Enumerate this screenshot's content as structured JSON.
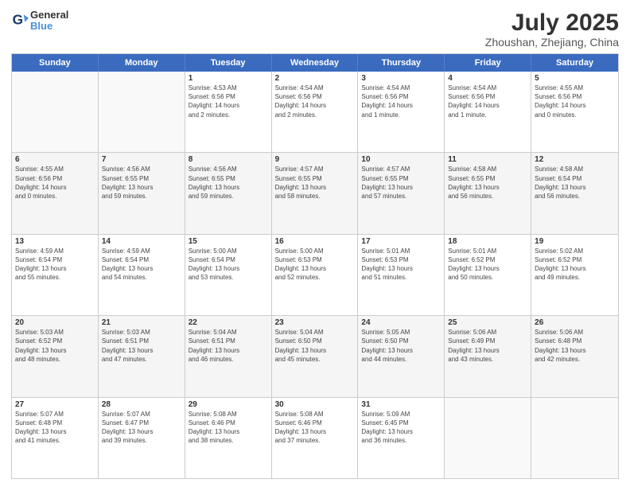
{
  "header": {
    "logo_line1": "General",
    "logo_line2": "Blue",
    "title": "July 2025",
    "subtitle": "Zhoushan, Zhejiang, China"
  },
  "days_of_week": [
    "Sunday",
    "Monday",
    "Tuesday",
    "Wednesday",
    "Thursday",
    "Friday",
    "Saturday"
  ],
  "rows": [
    [
      {
        "day": "",
        "detail": ""
      },
      {
        "day": "",
        "detail": ""
      },
      {
        "day": "1",
        "detail": "Sunrise: 4:53 AM\nSunset: 6:56 PM\nDaylight: 14 hours\nand 2 minutes."
      },
      {
        "day": "2",
        "detail": "Sunrise: 4:54 AM\nSunset: 6:56 PM\nDaylight: 14 hours\nand 2 minutes."
      },
      {
        "day": "3",
        "detail": "Sunrise: 4:54 AM\nSunset: 6:56 PM\nDaylight: 14 hours\nand 1 minute."
      },
      {
        "day": "4",
        "detail": "Sunrise: 4:54 AM\nSunset: 6:56 PM\nDaylight: 14 hours\nand 1 minute."
      },
      {
        "day": "5",
        "detail": "Sunrise: 4:55 AM\nSunset: 6:56 PM\nDaylight: 14 hours\nand 0 minutes."
      }
    ],
    [
      {
        "day": "6",
        "detail": "Sunrise: 4:55 AM\nSunset: 6:56 PM\nDaylight: 14 hours\nand 0 minutes."
      },
      {
        "day": "7",
        "detail": "Sunrise: 4:56 AM\nSunset: 6:55 PM\nDaylight: 13 hours\nand 59 minutes."
      },
      {
        "day": "8",
        "detail": "Sunrise: 4:56 AM\nSunset: 6:55 PM\nDaylight: 13 hours\nand 59 minutes."
      },
      {
        "day": "9",
        "detail": "Sunrise: 4:57 AM\nSunset: 6:55 PM\nDaylight: 13 hours\nand 58 minutes."
      },
      {
        "day": "10",
        "detail": "Sunrise: 4:57 AM\nSunset: 6:55 PM\nDaylight: 13 hours\nand 57 minutes."
      },
      {
        "day": "11",
        "detail": "Sunrise: 4:58 AM\nSunset: 6:55 PM\nDaylight: 13 hours\nand 56 minutes."
      },
      {
        "day": "12",
        "detail": "Sunrise: 4:58 AM\nSunset: 6:54 PM\nDaylight: 13 hours\nand 56 minutes."
      }
    ],
    [
      {
        "day": "13",
        "detail": "Sunrise: 4:59 AM\nSunset: 6:54 PM\nDaylight: 13 hours\nand 55 minutes."
      },
      {
        "day": "14",
        "detail": "Sunrise: 4:59 AM\nSunset: 6:54 PM\nDaylight: 13 hours\nand 54 minutes."
      },
      {
        "day": "15",
        "detail": "Sunrise: 5:00 AM\nSunset: 6:54 PM\nDaylight: 13 hours\nand 53 minutes."
      },
      {
        "day": "16",
        "detail": "Sunrise: 5:00 AM\nSunset: 6:53 PM\nDaylight: 13 hours\nand 52 minutes."
      },
      {
        "day": "17",
        "detail": "Sunrise: 5:01 AM\nSunset: 6:53 PM\nDaylight: 13 hours\nand 51 minutes."
      },
      {
        "day": "18",
        "detail": "Sunrise: 5:01 AM\nSunset: 6:52 PM\nDaylight: 13 hours\nand 50 minutes."
      },
      {
        "day": "19",
        "detail": "Sunrise: 5:02 AM\nSunset: 6:52 PM\nDaylight: 13 hours\nand 49 minutes."
      }
    ],
    [
      {
        "day": "20",
        "detail": "Sunrise: 5:03 AM\nSunset: 6:52 PM\nDaylight: 13 hours\nand 48 minutes."
      },
      {
        "day": "21",
        "detail": "Sunrise: 5:03 AM\nSunset: 6:51 PM\nDaylight: 13 hours\nand 47 minutes."
      },
      {
        "day": "22",
        "detail": "Sunrise: 5:04 AM\nSunset: 6:51 PM\nDaylight: 13 hours\nand 46 minutes."
      },
      {
        "day": "23",
        "detail": "Sunrise: 5:04 AM\nSunset: 6:50 PM\nDaylight: 13 hours\nand 45 minutes."
      },
      {
        "day": "24",
        "detail": "Sunrise: 5:05 AM\nSunset: 6:50 PM\nDaylight: 13 hours\nand 44 minutes."
      },
      {
        "day": "25",
        "detail": "Sunrise: 5:06 AM\nSunset: 6:49 PM\nDaylight: 13 hours\nand 43 minutes."
      },
      {
        "day": "26",
        "detail": "Sunrise: 5:06 AM\nSunset: 6:48 PM\nDaylight: 13 hours\nand 42 minutes."
      }
    ],
    [
      {
        "day": "27",
        "detail": "Sunrise: 5:07 AM\nSunset: 6:48 PM\nDaylight: 13 hours\nand 41 minutes."
      },
      {
        "day": "28",
        "detail": "Sunrise: 5:07 AM\nSunset: 6:47 PM\nDaylight: 13 hours\nand 39 minutes."
      },
      {
        "day": "29",
        "detail": "Sunrise: 5:08 AM\nSunset: 6:46 PM\nDaylight: 13 hours\nand 38 minutes."
      },
      {
        "day": "30",
        "detail": "Sunrise: 5:08 AM\nSunset: 6:46 PM\nDaylight: 13 hours\nand 37 minutes."
      },
      {
        "day": "31",
        "detail": "Sunrise: 5:09 AM\nSunset: 6:45 PM\nDaylight: 13 hours\nand 36 minutes."
      },
      {
        "day": "",
        "detail": ""
      },
      {
        "day": "",
        "detail": ""
      }
    ]
  ]
}
